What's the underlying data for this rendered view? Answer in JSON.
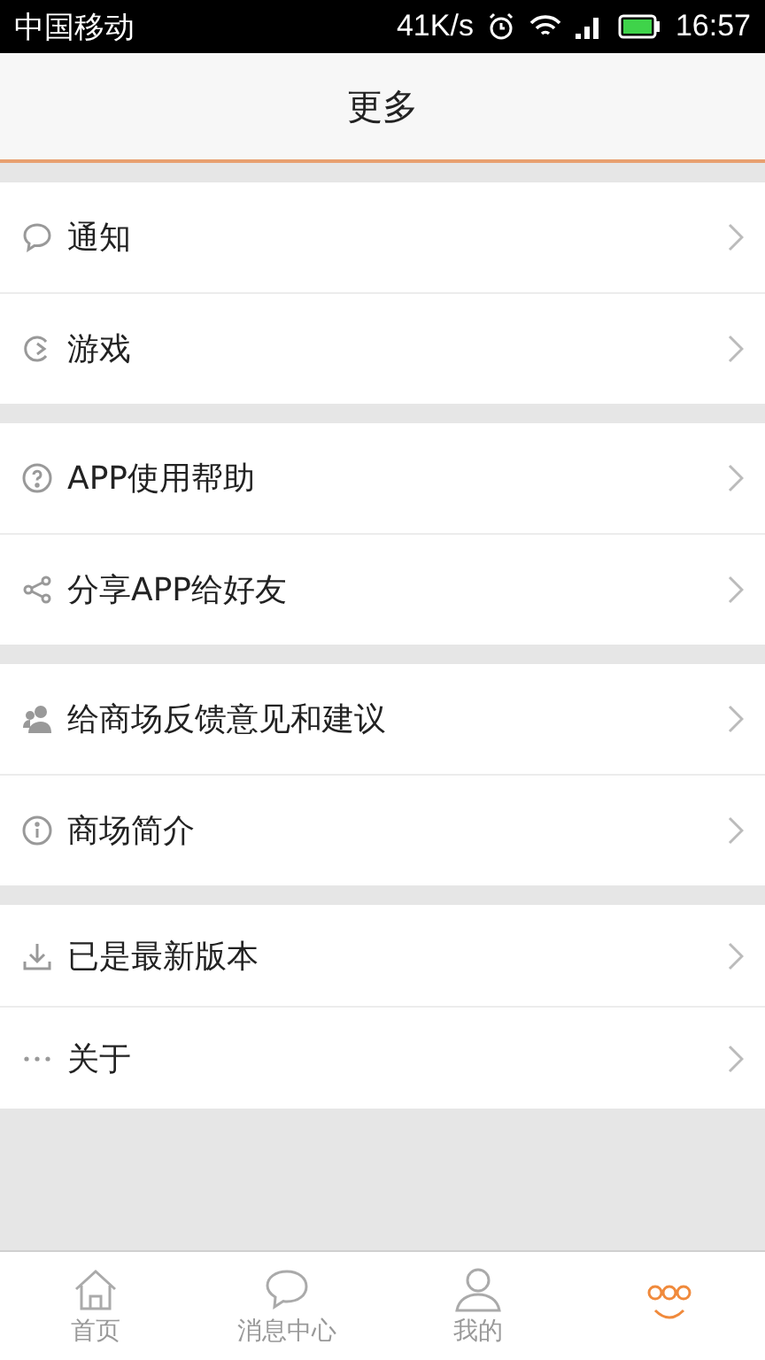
{
  "status_bar": {
    "carrier": "中国移动",
    "speed": "41K/s",
    "time": "16:57"
  },
  "header": {
    "title": "更多"
  },
  "groups": [
    {
      "items": [
        {
          "kind": "chat",
          "label": "通知"
        },
        {
          "kind": "game",
          "label": "游戏"
        }
      ]
    },
    {
      "items": [
        {
          "kind": "help",
          "label": "APP使用帮助"
        },
        {
          "kind": "share",
          "label": "分享APP给好友"
        }
      ]
    },
    {
      "items": [
        {
          "kind": "feedback",
          "label": "给商场反馈意见和建议"
        },
        {
          "kind": "info",
          "label": "商场简介"
        }
      ]
    },
    {
      "items": [
        {
          "kind": "download",
          "label": "已是最新版本"
        },
        {
          "kind": "more",
          "label": "关于"
        }
      ]
    }
  ],
  "tabs": [
    {
      "kind": "home",
      "label": "首页",
      "selected": false
    },
    {
      "kind": "chat",
      "label": "消息中心",
      "selected": false
    },
    {
      "kind": "user",
      "label": "我的",
      "selected": false
    },
    {
      "kind": "more",
      "selected": true
    }
  ]
}
